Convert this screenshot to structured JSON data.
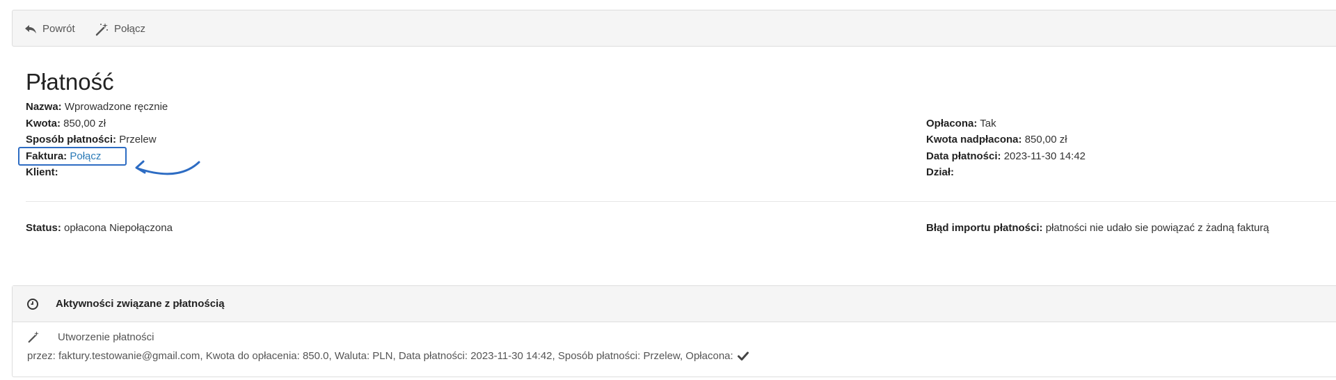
{
  "toolbar": {
    "back_label": "Powrót",
    "connect_label": "Połącz"
  },
  "page_title": "Płatność",
  "left": {
    "name_label": "Nazwa:",
    "name_value": "Wprowadzone ręcznie",
    "amount_label": "Kwota:",
    "amount_value": "850,00 zł",
    "method_label": "Sposób płatności:",
    "method_value": "Przelew",
    "invoice_label": "Faktura:",
    "invoice_link": "Połącz",
    "client_label": "Klient:"
  },
  "right": {
    "paid_label": "Opłacona:",
    "paid_value": "Tak",
    "overpaid_label": "Kwota nadpłacona:",
    "overpaid_value": "850,00 zł",
    "date_label": "Data płatności:",
    "date_value": "2023-11-30 14:42",
    "dept_label": "Dział:"
  },
  "status": {
    "label": "Status:",
    "value": "opłacona Niepołączona",
    "error_label": "Błąd importu płatności:",
    "error_value": "płatności nie udało sie powiązać z żadną fakturą"
  },
  "activities": {
    "title": "Aktywności związane z płatnością",
    "items": [
      {
        "title": "Utworzenie płatności",
        "detail": "przez: faktury.testowanie@gmail.com, Kwota do opłacenia: 850.0, Waluta: PLN, Data płatności: 2023-11-30 14:42, Sposób płatności: Przelew, Opłacona:"
      }
    ]
  },
  "colors": {
    "link": "#2a7ab7",
    "annotation": "#2d6cc3"
  },
  "icons": [
    "reply-icon",
    "magic-wand-icon",
    "clock-icon",
    "check-icon"
  ]
}
